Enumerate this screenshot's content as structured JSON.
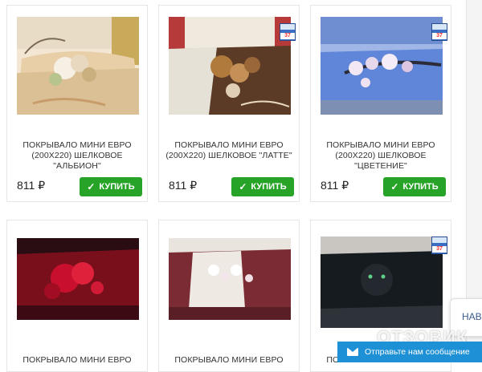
{
  "products": [
    {
      "title": "Покрывало мини евро (200х220) шелковое \"Альбион\"",
      "price": "811 ₽",
      "buy_label": "КУПИТЬ",
      "image": "bed-cream-flowers"
    },
    {
      "title": "Покрывало мини евро (200х220) шелковое \"Латте\"",
      "price": "811 ₽",
      "buy_label": "КУПИТЬ",
      "image": "bed-brown-latte",
      "badge": "37"
    },
    {
      "title": "Покрывало мини евро (200х220) шелковое \"Цветение\"",
      "price": "811 ₽",
      "buy_label": "КУПИТЬ",
      "image": "bed-blue-blossom",
      "badge": "37"
    },
    {
      "title": "Покрывало мини евро",
      "image": "bed-red-roses"
    },
    {
      "title": "Покрывало мини евро",
      "image": "bed-brown-orchid"
    },
    {
      "title": "Покрывало мини евро",
      "image": "bed-black-panther",
      "badge": "37"
    }
  ],
  "side_tab": {
    "label": "НАВ"
  },
  "watermark": {
    "text": "ОТЗОВИК"
  },
  "message_bar": {
    "label": "Отправьте нам сообщение",
    "icon": "envelope-icon"
  },
  "colors": {
    "buy_button": "#27a327",
    "message_bar": "#1e90d6"
  }
}
